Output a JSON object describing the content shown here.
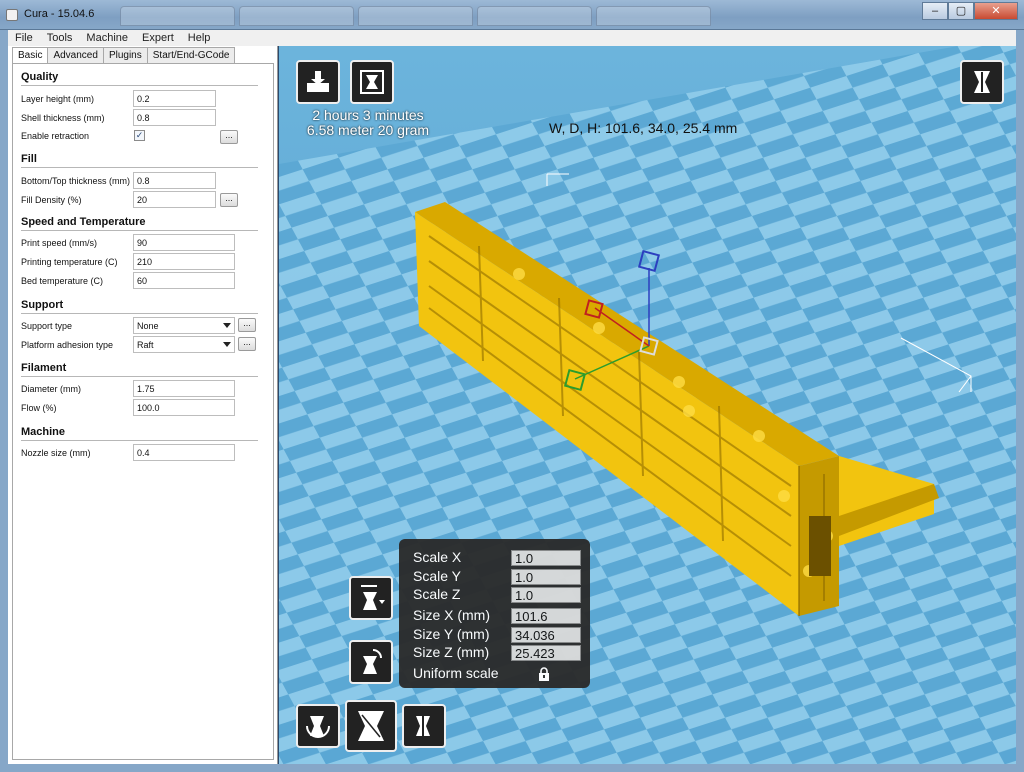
{
  "window": {
    "title": "Cura - 15.04.6",
    "background_tabs": [
      "",
      "",
      "",
      "",
      ""
    ]
  },
  "menu": [
    "File",
    "Tools",
    "Machine",
    "Expert",
    "Help"
  ],
  "tabs": [
    "Basic",
    "Advanced",
    "Plugins",
    "Start/End-GCode"
  ],
  "sections": {
    "quality": {
      "title": "Quality",
      "layer_height": {
        "label": "Layer height (mm)",
        "value": "0.2"
      },
      "shell_thickness": {
        "label": "Shell thickness (mm)",
        "value": "0.8"
      },
      "retraction": {
        "label": "Enable retraction",
        "checked": "✓",
        "more": "..."
      }
    },
    "fill": {
      "title": "Fill",
      "bottom_top": {
        "label": "Bottom/Top thickness (mm)",
        "value": "0.8"
      },
      "density": {
        "label": "Fill Density (%)",
        "value": "20",
        "more": "..."
      }
    },
    "speed": {
      "title": "Speed and Temperature",
      "print_speed": {
        "label": "Print speed (mm/s)",
        "value": "90"
      },
      "print_temp": {
        "label": "Printing temperature (C)",
        "value": "210"
      },
      "bed_temp": {
        "label": "Bed temperature (C)",
        "value": "60"
      }
    },
    "support": {
      "title": "Support",
      "type": {
        "label": "Support type",
        "value": "None",
        "more": "..."
      },
      "adhesion": {
        "label": "Platform adhesion type",
        "value": "Raft",
        "more": "..."
      }
    },
    "filament": {
      "title": "Filament",
      "diameter": {
        "label": "Diameter (mm)",
        "value": "1.75"
      },
      "flow": {
        "label": "Flow (%)",
        "value": "100.0"
      }
    },
    "machine": {
      "title": "Machine",
      "nozzle": {
        "label": "Nozzle size (mm)",
        "value": "0.4"
      }
    }
  },
  "viewport": {
    "print_time": "2 hours 3 minutes",
    "print_material": "6.58 meter 20 gram",
    "dimensions": "W, D, H: 101.6, 34.0, 25.4 mm",
    "colors": {
      "floor_light": "#8fcbea",
      "floor_dark": "#5aa6d2",
      "model": "#f2c40f",
      "model_shadow": "#b58c00"
    }
  },
  "scale_panel": {
    "rows": [
      {
        "label": "Scale X",
        "value": "1.0"
      },
      {
        "label": "Scale Y",
        "value": "1.0"
      },
      {
        "label": "Scale Z",
        "value": "1.0"
      },
      {
        "label": "Size X (mm)",
        "value": "101.6"
      },
      {
        "label": "Size Y (mm)",
        "value": "34.036"
      },
      {
        "label": "Size Z (mm)",
        "value": "25.423"
      }
    ],
    "uniform_label": "Uniform scale",
    "lock_icon": "padlock-icon"
  },
  "toolbar_icons": [
    "load-model-icon",
    "save-toolpath-icon",
    "view-mode-icon",
    "lay-flat-icon",
    "reset-icon",
    "rotate-icon",
    "scale-icon",
    "mirror-icon"
  ]
}
